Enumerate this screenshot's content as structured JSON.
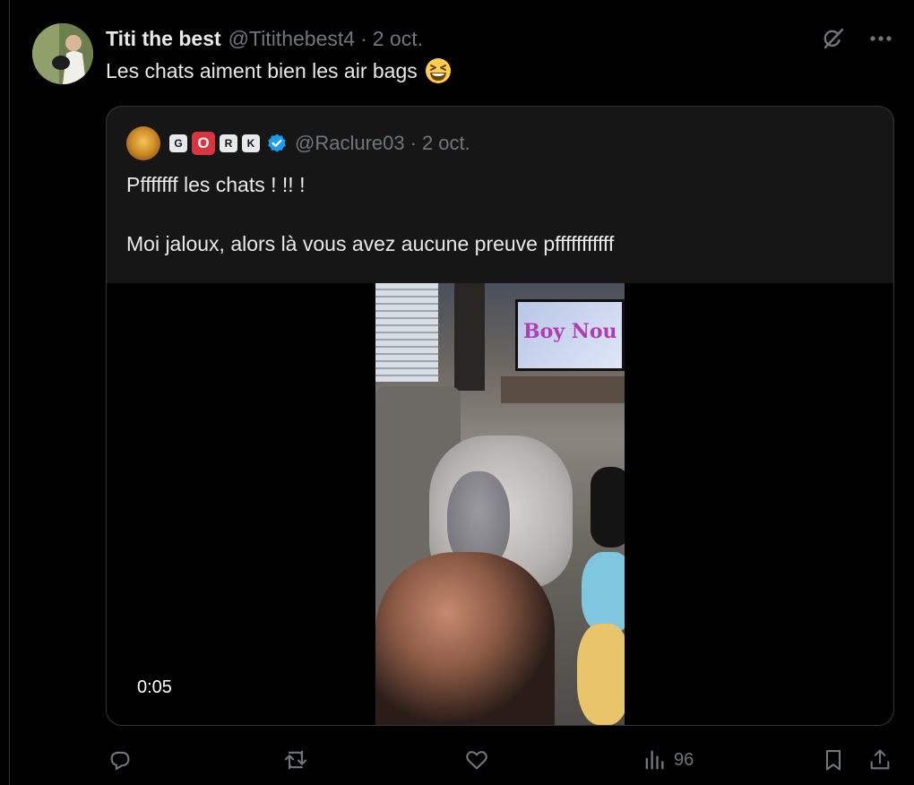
{
  "tweet": {
    "display_name": "Titi the best",
    "handle": "@Titithebest4",
    "separator": "·",
    "date": "2 oct.",
    "text": "Les chats aiment bien les air bags",
    "emoji": "grinning-squinting-face-emoji"
  },
  "top_icons": [
    "grok-icon",
    "more-icon"
  ],
  "quoted_tweet": {
    "badges": [
      "G",
      "O",
      "R",
      "K"
    ],
    "handle": "@Raclure03",
    "separator": "·",
    "date": "2 oct.",
    "text_line1": "Pfffffff les chats ! !! !",
    "text_line2": "Moi jaloux, alors là vous avez aucune preuve pfffffffffff",
    "video": {
      "timestamp": "0:05",
      "tv_text": "Boy Nou"
    }
  },
  "actions": {
    "views": "96"
  },
  "colors": {
    "background": "#000000",
    "text": "#e7e9ea",
    "muted": "#71767b",
    "border": "#333639",
    "verified": "#1d9bf0",
    "badge_red": "#d9353f"
  }
}
